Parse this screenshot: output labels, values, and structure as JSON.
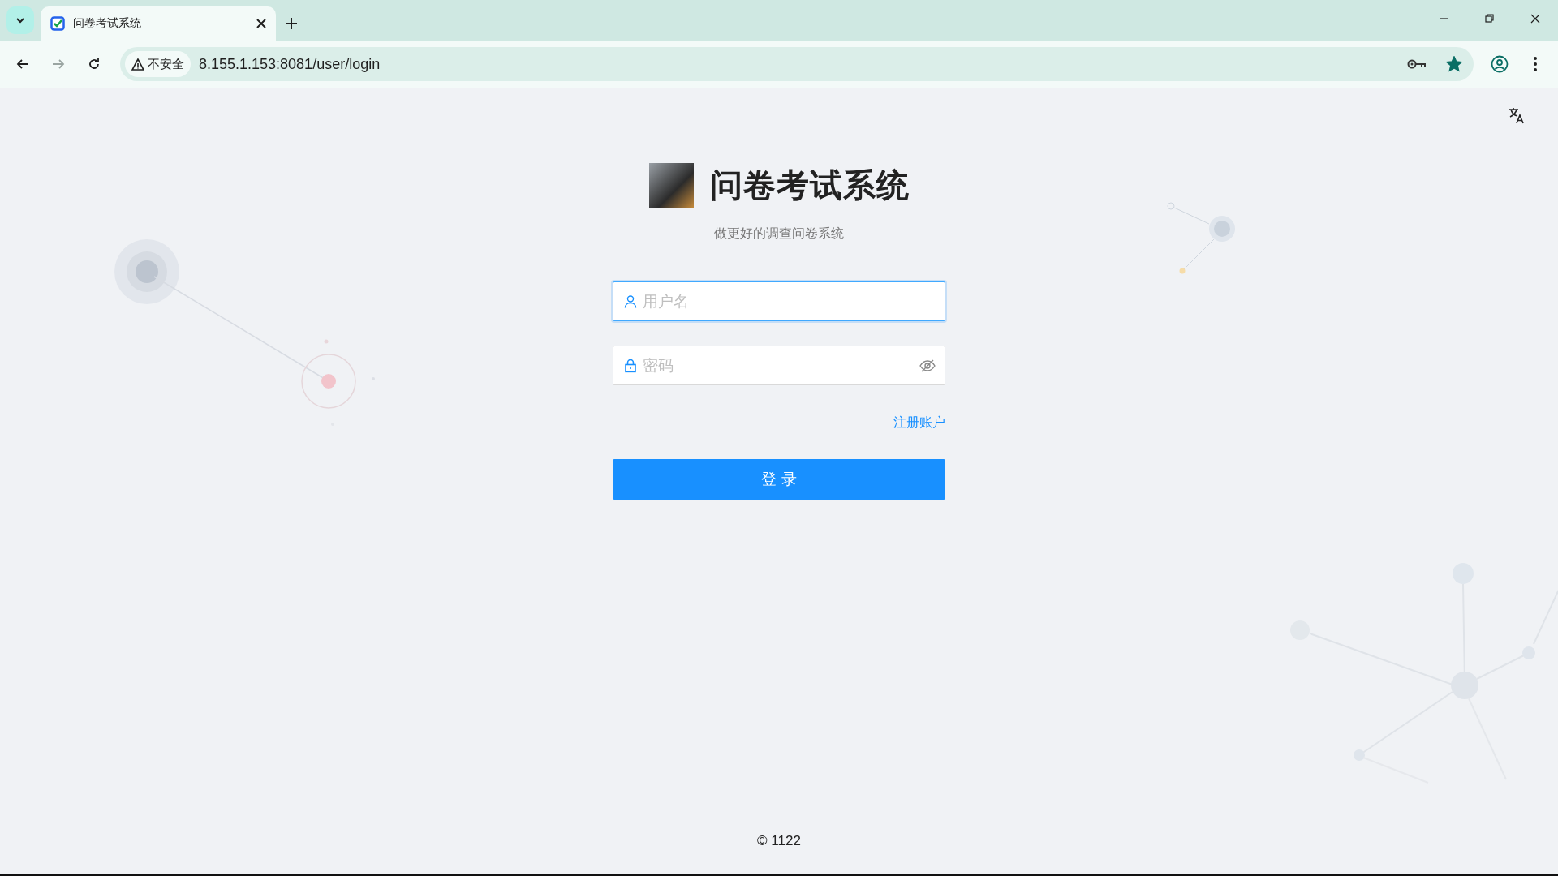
{
  "browser": {
    "tabs": [
      {
        "title": "问卷考试系统",
        "selected": true
      }
    ],
    "security_label": "不安全",
    "url": "8.155.1.153:8081/user/login",
    "bookmarked": true
  },
  "header": {
    "title": "问卷考试系统",
    "subtitle": "做更好的调查问卷系统"
  },
  "form": {
    "fields": [
      {
        "kind": "username",
        "placeholder": "用户名",
        "focused": true
      },
      {
        "kind": "password",
        "placeholder": "密码",
        "focused": false,
        "password_visible": false
      }
    ],
    "register_link": "注册账户",
    "submit_button": "登 录"
  },
  "footer": {
    "copyright_symbol": "©",
    "text": "1122"
  }
}
